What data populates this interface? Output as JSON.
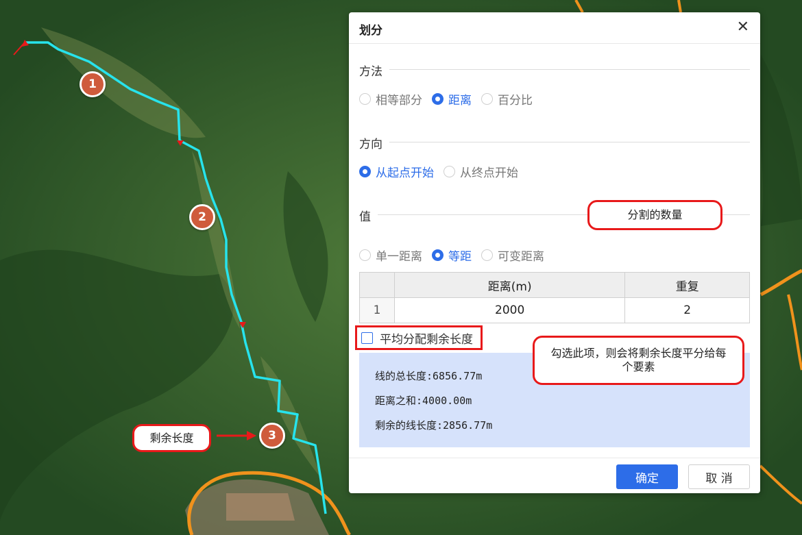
{
  "colors": {
    "accent": "#2d6de8",
    "annotation_red": "#e8191a",
    "marker": "#cf5b3c",
    "route": "#27e3ec",
    "road": "#f0921c"
  },
  "map": {
    "markers": [
      "1",
      "2",
      "3"
    ],
    "callouts": {
      "split_count": "分割的数量",
      "check_tip": "勾选此项，则会将剩余长度平分给每个要素",
      "remaining": "剩余长度"
    }
  },
  "dialog": {
    "title": "划分",
    "close_icon": "close-icon",
    "method": {
      "label": "方法",
      "options": [
        "相等部分",
        "距离",
        "百分比"
      ],
      "selected": "距离"
    },
    "direction": {
      "label": "方向",
      "options": [
        "从起点开始",
        "从终点开始"
      ],
      "selected": "从起点开始"
    },
    "value": {
      "label": "值",
      "options": [
        "单一距离",
        "等距",
        "可变距离"
      ],
      "selected": "等距"
    },
    "table": {
      "headers": [
        "",
        "距离(m)",
        "重复"
      ],
      "rows": [
        {
          "index": "1",
          "distance": "2000",
          "repeat": "2"
        }
      ]
    },
    "checkbox": {
      "label": "平均分配剩余长度",
      "checked": false
    },
    "info": {
      "total": "线的总长度:6856.77m",
      "sum": "距离之和:4000.00m",
      "remaining": "剩余的线长度:2856.77m"
    },
    "buttons": {
      "ok": "确定",
      "cancel": "取 消"
    }
  }
}
